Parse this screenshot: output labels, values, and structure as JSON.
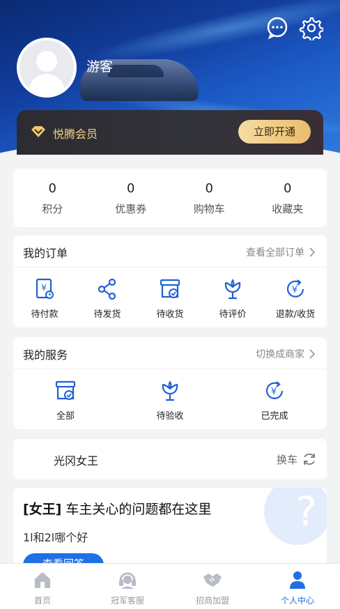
{
  "colors": {
    "accent": "#1f6fe5",
    "icon": "#1f5fd8",
    "vip_gold": "#f3cf86"
  },
  "header": {
    "username": "游客"
  },
  "vip": {
    "label": "悦腾会员",
    "button": "立即开通"
  },
  "stats": [
    {
      "value": "0",
      "label": "积分"
    },
    {
      "value": "0",
      "label": "优惠券"
    },
    {
      "value": "0",
      "label": "购物车"
    },
    {
      "value": "0",
      "label": "收藏夹"
    }
  ],
  "orders": {
    "title": "我的订单",
    "more": "查看全部订单",
    "items": [
      {
        "label": "待付款",
        "icon": "payment-icon"
      },
      {
        "label": "待发货",
        "icon": "share-icon"
      },
      {
        "label": "待收货",
        "icon": "box-check-icon"
      },
      {
        "label": "待评价",
        "icon": "flower-icon"
      },
      {
        "label": "退款/收货",
        "icon": "refund-icon"
      }
    ]
  },
  "services": {
    "title": "我的服务",
    "more": "切换成商家",
    "items": [
      {
        "label": "全部",
        "icon": "box-check-icon"
      },
      {
        "label": "待验收",
        "icon": "flower-icon"
      },
      {
        "label": "已完成",
        "icon": "refund-icon"
      }
    ]
  },
  "car": {
    "name": "光冈女王",
    "swap": "换车"
  },
  "qa": {
    "tag": "[女王]",
    "title": "车主关心的问题都在这里",
    "question": "1l和2l哪个好",
    "button": "查看回答"
  },
  "tabs": [
    {
      "label": "首页",
      "icon": "home-icon"
    },
    {
      "label": "冠军客服",
      "icon": "headset-icon"
    },
    {
      "label": "招商加盟",
      "icon": "handshake-icon"
    },
    {
      "label": "个人中心",
      "icon": "person-icon",
      "active": true
    }
  ]
}
